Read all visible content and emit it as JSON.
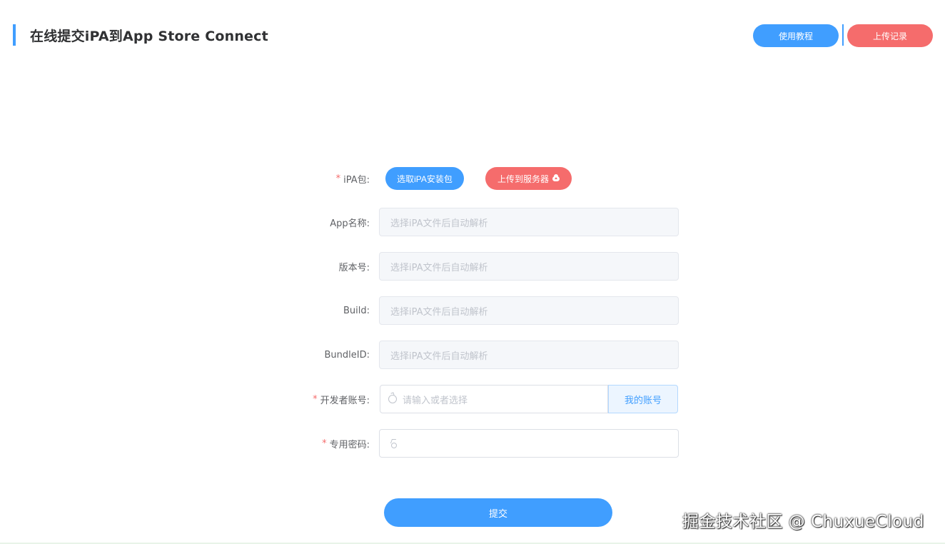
{
  "header": {
    "title": "在线提交iPA到App Store Connect",
    "tutorial_label": "使用教程",
    "records_label": "上传记录"
  },
  "form": {
    "ipa": {
      "label": "iPA包:",
      "select_label": "选取iPA安装包",
      "upload_label": "上传到服务器"
    },
    "app_name": {
      "label": "App名称:",
      "placeholder": "选择iPA文件后自动解析"
    },
    "version": {
      "label": "版本号:",
      "placeholder": "选择iPA文件后自动解析"
    },
    "build": {
      "label": "Build:",
      "placeholder": "选择iPA文件后自动解析"
    },
    "bundle_id": {
      "label": "BundleID:",
      "placeholder": "选择iPA文件后自动解析"
    },
    "developer_account": {
      "label": "开发者账号:",
      "placeholder": "请输入或者选择",
      "my_account_label": "我的账号"
    },
    "password": {
      "label": "专用密码:",
      "placeholder": ""
    },
    "required_mark": "*",
    "submit_label": "提交"
  },
  "watermark": "掘金技术社区 @ ChuxueCloud",
  "colors": {
    "primary": "#409eff",
    "danger": "#f56c6c"
  },
  "icons": {
    "upload": "cloud-upload-icon",
    "account": "apple-icon",
    "password": "lock-icon"
  }
}
